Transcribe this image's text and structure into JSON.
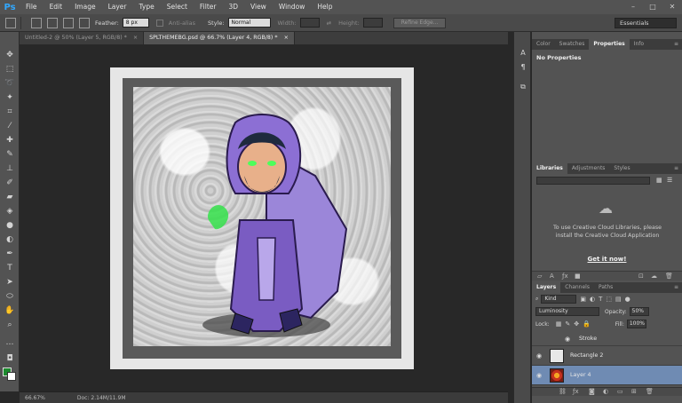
{
  "app": {
    "logo": "Ps"
  },
  "menu": [
    "File",
    "Edit",
    "Image",
    "Layer",
    "Type",
    "Select",
    "Filter",
    "3D",
    "View",
    "Window",
    "Help"
  ],
  "window_controls": [
    "–",
    "□",
    "✕"
  ],
  "options": {
    "feather_label": "Feather:",
    "feather_value": "8 px",
    "antialias_label": "Anti-alias",
    "style_label": "Style:",
    "style_value": "Normal",
    "width_label": "Width:",
    "height_label": "Height:",
    "refine_edge_label": "Refine Edge...",
    "workspace": "Essentials"
  },
  "tabs": [
    {
      "label": "Untitled-2 @ 50% (Layer 5, RGB/8) *",
      "close": "×"
    },
    {
      "label": "SPLTHEMEBG.psd @ 66.7% (Layer 4, RGB/8) *",
      "close": "×"
    }
  ],
  "status": {
    "zoom": "66.67%",
    "doc": "Doc: 2.14M/11.9M"
  },
  "colors": {
    "foreground": "#1d8a2e",
    "background": "#ffffff",
    "accent": "#31a8ff",
    "selection": "#6f8bb3"
  },
  "properties_panel": {
    "tabs": [
      "Color",
      "Swatches",
      "Properties",
      "Info"
    ],
    "title": "No Properties"
  },
  "libraries_panel": {
    "tabs": [
      "Libraries",
      "Adjustments",
      "Styles"
    ],
    "message": "To use Creative Cloud Libraries, please install the Creative Cloud Application",
    "link": "Get it now!"
  },
  "layers_panel": {
    "tabs": [
      "Layers",
      "Channels",
      "Paths"
    ],
    "filter_kind": "Kind",
    "blend_mode": "Luminosity",
    "opacity_label": "Opacity:",
    "opacity_value": "50%",
    "lock_label": "Lock:",
    "fill_label": "Fill:",
    "fill_value": "100%",
    "layers": [
      {
        "name": "Stroke"
      },
      {
        "name": "Rectangle 2"
      },
      {
        "name": "Layer 4"
      }
    ]
  }
}
